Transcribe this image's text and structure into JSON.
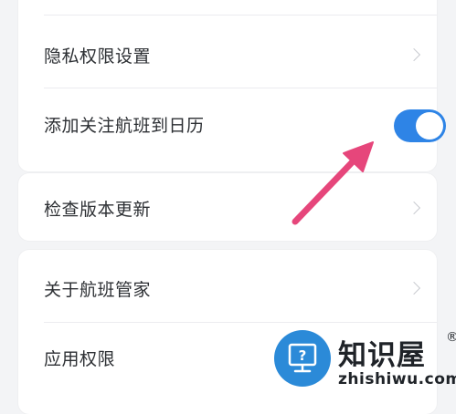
{
  "settings": {
    "group1": {
      "privacy_label": "隐私权限设置",
      "calendar_label": "添加关注航班到日历",
      "calendar_toggle_on": true
    },
    "group2": {
      "update_label": "检查版本更新"
    },
    "group3": {
      "about_label": "关于航班管家",
      "permissions_label": "应用权限"
    }
  },
  "watermark": {
    "title": "知识屋",
    "registered": "®",
    "subtitle": "zhishiwu.com"
  },
  "colors": {
    "toggle_on": "#2e84e6",
    "arrow": "#e6467b",
    "watermark_badge": "#2b8ad8"
  },
  "icons": {
    "chevron": "chevron-right-icon",
    "arrow": "pink-pointer-arrow",
    "badge": "question-monitor-icon"
  }
}
